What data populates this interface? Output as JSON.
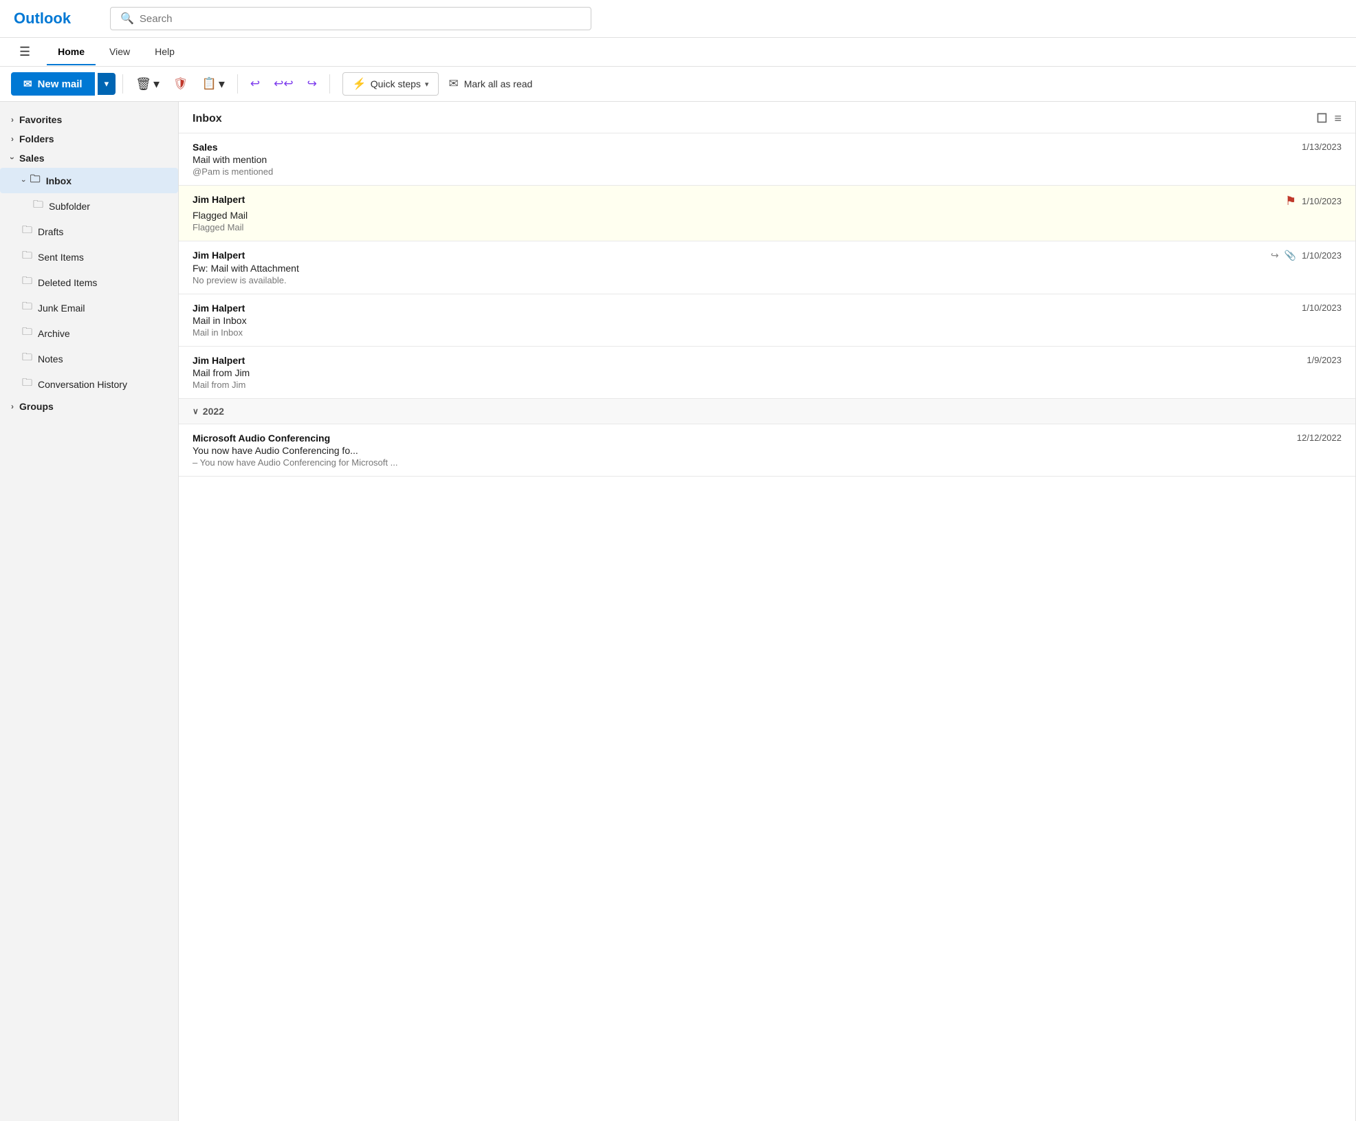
{
  "app": {
    "title": "Outlook"
  },
  "search": {
    "placeholder": "Search"
  },
  "nav": {
    "hamburger": "☰",
    "tabs": [
      {
        "label": "Home",
        "active": true
      },
      {
        "label": "View",
        "active": false
      },
      {
        "label": "Help",
        "active": false
      }
    ]
  },
  "toolbar": {
    "new_mail_label": "New mail",
    "new_mail_icon": "✉",
    "dropdown_arrow": "▾",
    "delete_icon": "🗑",
    "junk_icon": "🛡",
    "move_icon": "📋",
    "reply_icon": "↩",
    "reply_all_icon": "↩↩",
    "forward_icon": "↪",
    "quick_steps_label": "Quick steps",
    "quick_steps_icon": "⚡",
    "mark_read_label": "Mark all as read",
    "mark_read_icon": "✉"
  },
  "sidebar": {
    "favorites_label": "Favorites",
    "folders_label": "Folders",
    "sales_label": "Sales",
    "inbox_label": "Inbox",
    "subfolder_label": "Subfolder",
    "drafts_label": "Drafts",
    "sent_items_label": "Sent Items",
    "deleted_items_label": "Deleted Items",
    "junk_email_label": "Junk Email",
    "archive_label": "Archive",
    "notes_label": "Notes",
    "conv_history_label": "Conversation History",
    "groups_label": "Groups"
  },
  "email_list": {
    "header": "Inbox",
    "emails": [
      {
        "sender": "Sales",
        "subject": "Mail with mention",
        "preview": "@Pam is mentioned",
        "date": "1/13/2023",
        "flagged": false,
        "has_forward_icon": false,
        "has_attachment_icon": false
      },
      {
        "sender": "Jim Halpert",
        "subject": "Flagged Mail",
        "preview": "Flagged Mail",
        "date": "1/10/2023",
        "flagged": true,
        "has_forward_icon": false,
        "has_attachment_icon": false
      },
      {
        "sender": "Jim Halpert",
        "subject": "Fw: Mail with Attachment",
        "preview": "No preview is available.",
        "date": "1/10/2023",
        "flagged": false,
        "has_forward_icon": true,
        "has_attachment_icon": true
      },
      {
        "sender": "Jim Halpert",
        "subject": "Mail in Inbox",
        "preview": "Mail in Inbox",
        "date": "1/10/2023",
        "flagged": false,
        "has_forward_icon": false,
        "has_attachment_icon": false
      },
      {
        "sender": "Jim Halpert",
        "subject": "Mail from Jim",
        "preview": "Mail from Jim",
        "date": "1/9/2023",
        "flagged": false,
        "has_forward_icon": false,
        "has_attachment_icon": false
      }
    ],
    "section_2022_label": "2022",
    "section_2022_emails": [
      {
        "sender": "Microsoft Audio Conferencing",
        "subject": "You now have Audio Conferencing fo...",
        "preview": "– You now have Audio Conferencing for Microsoft ...",
        "date": "12/12/2022"
      }
    ]
  }
}
